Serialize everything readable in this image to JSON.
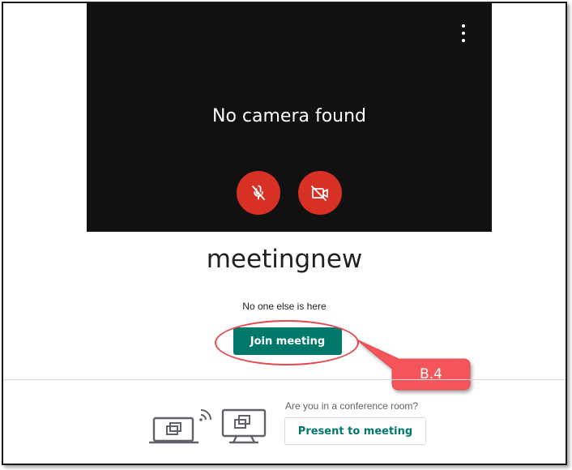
{
  "preview": {
    "status_text": "No camera found",
    "more_options_icon": "more-vert-icon",
    "mic_button_icon": "mic-off-icon",
    "camera_button_icon": "videocam-off-icon"
  },
  "meeting": {
    "title": "meetingnew",
    "presence_text": "No one else is here",
    "join_label": "Join meeting"
  },
  "annotation": {
    "label": "B.4",
    "color": "#e8464a"
  },
  "conference": {
    "question": "Are you in a conference room?",
    "present_label": "Present to meeting",
    "icon": "cast-to-room-icon"
  },
  "colors": {
    "accent": "#00796b",
    "danger": "#d93025",
    "preview_bg": "#111111"
  }
}
